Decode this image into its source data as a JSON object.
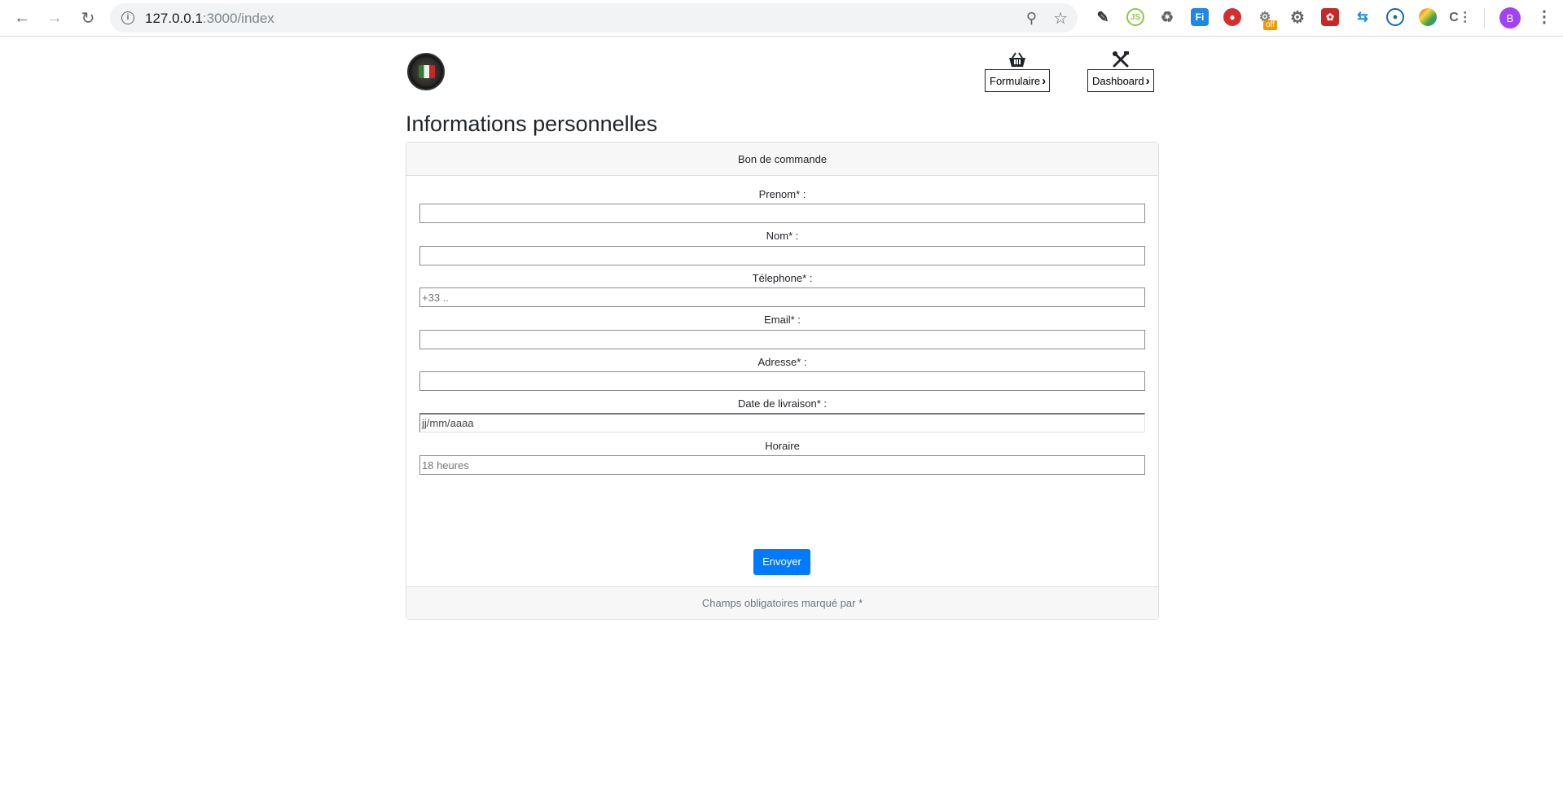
{
  "browser": {
    "url_host": "127.0.0.1",
    "url_rest": ":3000/index",
    "profile_initial": "B",
    "extension_badge": "off",
    "extensions": [
      "pencil-icon",
      "nodejs-icon",
      "recycle-icon",
      "fi-icon",
      "shield-icon",
      "robot-icon",
      "gear-icon",
      "red-puzzle-icon",
      "translate-icon",
      "blue-circle-icon",
      "color-picker-icon",
      "c-icon"
    ]
  },
  "nav": {
    "items": [
      {
        "label": "Formulaire",
        "icon": "basket-icon"
      },
      {
        "label": "Dashboard",
        "icon": "tools-icon"
      }
    ]
  },
  "page": {
    "title": "Informations personnelles"
  },
  "form": {
    "header": "Bon de commande",
    "fields": [
      {
        "label": "Prenom* :",
        "value": "",
        "placeholder": ""
      },
      {
        "label": "Nom* :",
        "value": "",
        "placeholder": ""
      },
      {
        "label": "Télephone* :",
        "value": "",
        "placeholder": "+33 .."
      },
      {
        "label": "Email* :",
        "value": "",
        "placeholder": ""
      },
      {
        "label": "Adresse* :",
        "value": "",
        "placeholder": ""
      },
      {
        "label": "Date de livraison* :",
        "value": "",
        "placeholder": "jj/mm/aaaa"
      },
      {
        "label": "Horaire",
        "value": "",
        "placeholder": "18 heures"
      }
    ],
    "submit_label": "Envoyer",
    "footer": "Champs obligatoires marqué par *"
  },
  "colors": {
    "primary": "#007bff",
    "card_header_bg": "#f7f7f7",
    "profile": "#a142f4"
  }
}
